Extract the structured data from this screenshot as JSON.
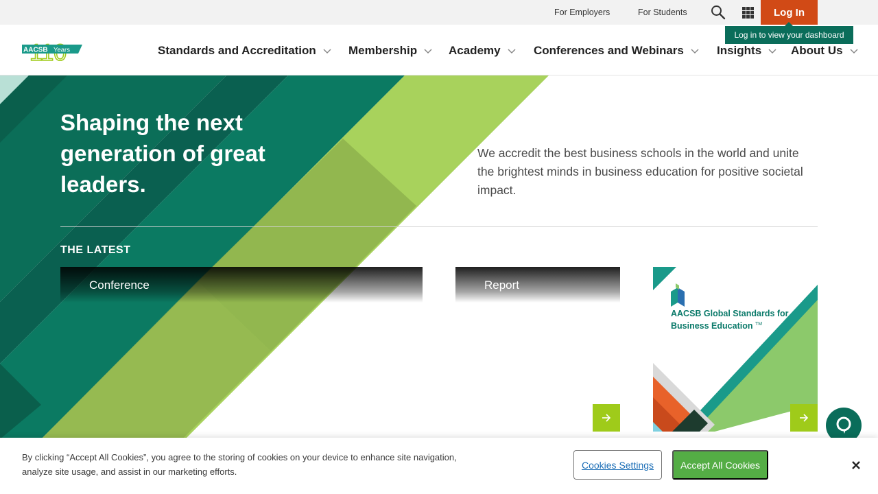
{
  "utility": {
    "for_employers": "For Employers",
    "for_students": "For Students",
    "login_label": "Log In",
    "login_tooltip": "Log in to view your dashboard"
  },
  "logo": {
    "brand": "AACSB",
    "anniversary_number": "110",
    "anniversary_word": "Years"
  },
  "nav": {
    "items": [
      {
        "label": "Standards and Accreditation"
      },
      {
        "label": "Membership"
      },
      {
        "label": "Academy"
      },
      {
        "label": "Conferences and Webinars"
      },
      {
        "label": "Insights"
      },
      {
        "label": "About Us"
      }
    ]
  },
  "hero": {
    "headline": "Shaping the next generation of great leaders.",
    "tagline": "We accredit the best business schools in the world and unite the brightest minds in business education for positive societal impact.",
    "latest_label": "THE LATEST"
  },
  "cards": [
    {
      "tag": "Conference"
    },
    {
      "tag": "Report"
    },
    {
      "title": "AACSB Global Standards for Business Education",
      "trademark": "TM"
    }
  ],
  "cookie": {
    "text": "By clicking “Accept All Cookies”, you agree to the storing of cookies on your device to enhance site navigation, analyze site usage, and assist in our marketing efforts.",
    "settings_label": "Cookies Settings",
    "accept_label": "Accept All Cookies"
  },
  "colors": {
    "accent_orange": "#d14a16",
    "brand_teal": "#0a6d5a",
    "lime_green": "#9fcb1a",
    "accept_green": "#54ad45"
  }
}
